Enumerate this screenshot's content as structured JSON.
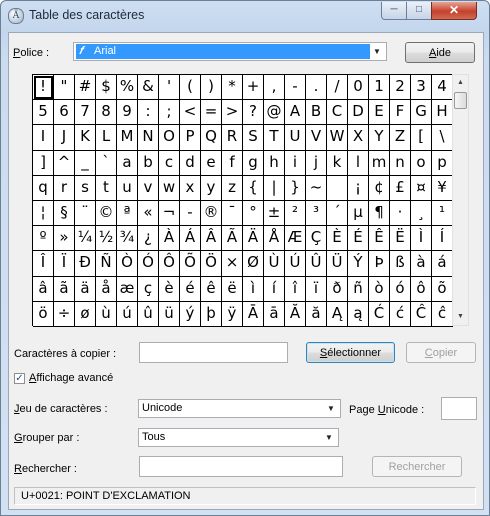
{
  "window": {
    "title": "Table des caractères"
  },
  "titlebar": {
    "minimize": "─",
    "maximize": "□",
    "close": "✕"
  },
  "font": {
    "label_prefix": "",
    "label_hotkey": "P",
    "label_rest": "olice :",
    "value": "Arial",
    "icon": "font-icon"
  },
  "help_button": {
    "hotkey": "A",
    "rest": "ide"
  },
  "grid": {
    "rows": [
      [
        "!",
        "\"",
        "#",
        "$",
        "%",
        "&",
        "'",
        "(",
        ")",
        "*",
        "+",
        ",",
        "-",
        ".",
        "/",
        "0",
        "1",
        "2",
        "3",
        "4"
      ],
      [
        "5",
        "6",
        "7",
        "8",
        "9",
        ":",
        ";",
        "<",
        "=",
        ">",
        "?",
        "@",
        "A",
        "B",
        "C",
        "D",
        "E",
        "F",
        "G",
        "H"
      ],
      [
        "I",
        "J",
        "K",
        "L",
        "M",
        "N",
        "O",
        "P",
        "Q",
        "R",
        "S",
        "T",
        "U",
        "V",
        "W",
        "X",
        "Y",
        "Z",
        "[",
        "\\"
      ],
      [
        "]",
        "^",
        "_",
        "`",
        "a",
        "b",
        "c",
        "d",
        "e",
        "f",
        "g",
        "h",
        "i",
        "j",
        "k",
        "l",
        "m",
        "n",
        "o",
        "p"
      ],
      [
        "q",
        "r",
        "s",
        "t",
        "u",
        "v",
        "w",
        "x",
        "y",
        "z",
        "{",
        "|",
        "}",
        "~",
        " ",
        "¡",
        "¢",
        "£",
        "¤",
        "¥"
      ],
      [
        "¦",
        "§",
        "¨",
        "©",
        "ª",
        "«",
        "¬",
        "-",
        "®",
        "¯",
        "°",
        "±",
        "²",
        "³",
        "´",
        "µ",
        "¶",
        "·",
        "¸",
        "¹"
      ],
      [
        "º",
        "»",
        "¼",
        "½",
        "¾",
        "¿",
        "À",
        "Á",
        "Â",
        "Ã",
        "Ä",
        "Å",
        "Æ",
        "Ç",
        "È",
        "É",
        "Ê",
        "Ë",
        "Ì",
        "Í"
      ],
      [
        "Î",
        "Ï",
        "Ð",
        "Ñ",
        "Ò",
        "Ó",
        "Ô",
        "Õ",
        "Ö",
        "×",
        "Ø",
        "Ù",
        "Ú",
        "Û",
        "Ü",
        "Ý",
        "Þ",
        "ß",
        "à",
        "á"
      ],
      [
        "â",
        "ã",
        "ä",
        "å",
        "æ",
        "ç",
        "è",
        "é",
        "ê",
        "ë",
        "ì",
        "í",
        "î",
        "ï",
        "ð",
        "ñ",
        "ò",
        "ó",
        "ô",
        "õ"
      ],
      [
        "ö",
        "÷",
        "ø",
        "ù",
        "ú",
        "û",
        "ü",
        "ý",
        "þ",
        "ÿ",
        "Ā",
        "ā",
        "Ă",
        "ă",
        "Ą",
        "ą",
        "Ć",
        "ć",
        "Ĉ",
        "ĉ"
      ]
    ],
    "selected": "!"
  },
  "copy": {
    "label": "Caractères à copier :",
    "value": "",
    "select_hotkey": "S",
    "select_rest": "électionner",
    "copy_hotkey": "C",
    "copy_rest": "opier"
  },
  "advanced": {
    "checked": true,
    "hotkey": "A",
    "rest": "ffichage avancé"
  },
  "charset": {
    "hotkey": "J",
    "rest": "eu de caractères :",
    "value": "Unicode"
  },
  "unicode_page": {
    "label_a": "Page ",
    "hotkey": "U",
    "label_b": "nicode :",
    "value": ""
  },
  "group": {
    "hotkey": "G",
    "rest": "rouper par :",
    "value": "Tous"
  },
  "search": {
    "hotkey": "R",
    "rest": "echercher :",
    "value": "",
    "button": "Rechercher"
  },
  "status": {
    "text": "U+0021: POINT D'EXCLAMATION"
  }
}
